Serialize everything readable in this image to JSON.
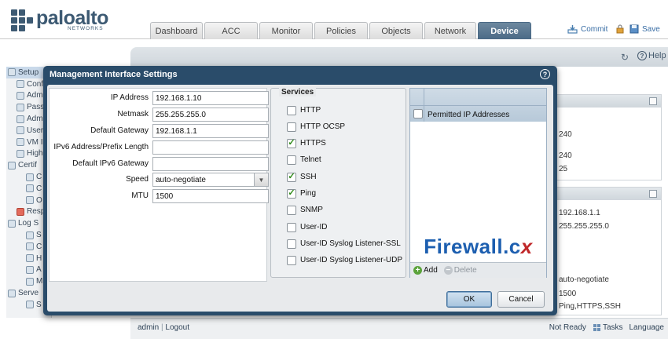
{
  "app": {
    "logo_text": "paloalto",
    "logo_subtext": "NETWORKS",
    "brand_color": "#3d5a73"
  },
  "nav_tabs": [
    {
      "label": "Dashboard",
      "active": false
    },
    {
      "label": "ACC",
      "active": false
    },
    {
      "label": "Monitor",
      "active": false
    },
    {
      "label": "Policies",
      "active": false
    },
    {
      "label": "Objects",
      "active": false
    },
    {
      "label": "Network",
      "active": false
    },
    {
      "label": "Device",
      "active": true
    }
  ],
  "header_actions": {
    "commit_label": "Commit",
    "save_label": "Save",
    "help_label": "Help"
  },
  "tree": {
    "items": [
      "Setup",
      "Config",
      "Admin",
      "Passw",
      "Admin",
      "User",
      "VM In",
      "High",
      "Certif",
      "C",
      "C",
      "O",
      "Respo",
      "Log S",
      "S",
      "C",
      "H",
      "A",
      "M",
      "Serve",
      "S"
    ]
  },
  "background_values": {
    "panel1": [
      "240",
      "240",
      "25"
    ],
    "panel2": [
      "192.168.1.1",
      "255.255.255.0",
      "auto-negotiate",
      "1500",
      "Ping,HTTPS,SSH"
    ]
  },
  "footer": {
    "user": "admin",
    "logout": "Logout",
    "status": "Not Ready",
    "tasks": "Tasks",
    "language": "Language"
  },
  "modal": {
    "title": "Management Interface Settings",
    "fields": [
      {
        "label": "IP Address",
        "value": "192.168.1.10"
      },
      {
        "label": "Netmask",
        "value": "255.255.255.0"
      },
      {
        "label": "Default Gateway",
        "value": "192.168.1.1"
      },
      {
        "label": "IPv6 Address/Prefix Length",
        "value": ""
      },
      {
        "label": "Default IPv6 Gateway",
        "value": ""
      },
      {
        "label": "Speed",
        "value": "auto-negotiate"
      },
      {
        "label": "MTU",
        "value": "1500"
      }
    ],
    "services_title": "Services",
    "services": [
      {
        "label": "HTTP",
        "checked": false
      },
      {
        "label": "HTTP OCSP",
        "checked": false
      },
      {
        "label": "HTTPS",
        "checked": true
      },
      {
        "label": "Telnet",
        "checked": false
      },
      {
        "label": "SSH",
        "checked": true
      },
      {
        "label": "Ping",
        "checked": true
      },
      {
        "label": "SNMP",
        "checked": false
      },
      {
        "label": "User-ID",
        "checked": false
      },
      {
        "label": "User-ID Syslog Listener-SSL",
        "checked": false
      },
      {
        "label": "User-ID Syslog Listener-UDP",
        "checked": false
      }
    ],
    "permitted_column": "Permitted IP Addresses",
    "watermark_main": "Firewall.c",
    "watermark_x": "x",
    "add_label": "Add",
    "delete_label": "Delete",
    "ok_label": "OK",
    "cancel_label": "Cancel"
  }
}
